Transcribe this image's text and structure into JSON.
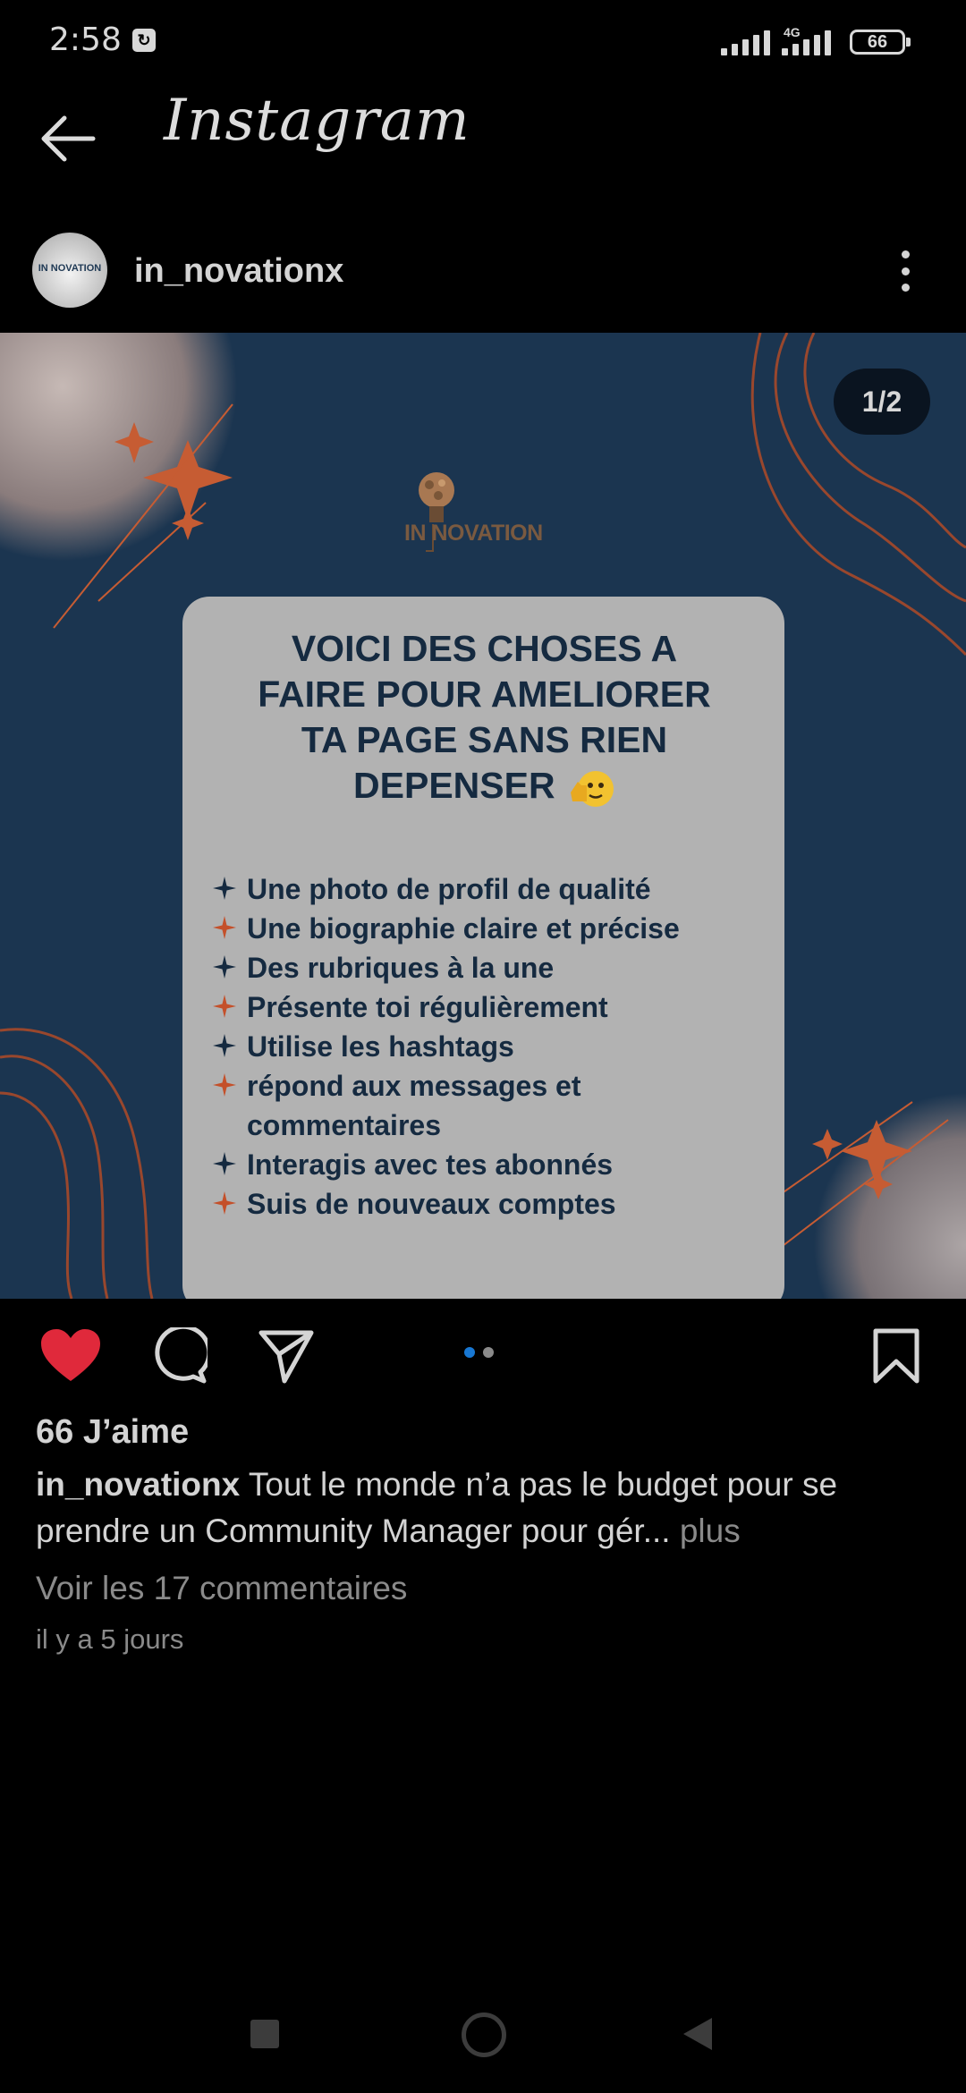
{
  "status_bar": {
    "time": "2:58",
    "network": "4G",
    "battery": "66"
  },
  "header": {
    "brand": "Instagram"
  },
  "post": {
    "username": "in_novationx",
    "avatar_text": "IN NOVATION",
    "carousel_counter": "1/2",
    "logo_text": "IN NOVATION",
    "image": {
      "title": "VOICI DES CHOSES A FAIRE POUR AMELIORER TA PAGE SANS RIEN DEPENSER",
      "title_lines": [
        "VOICI DES CHOSES A",
        "FAIRE POUR AMELIORER",
        "TA PAGE SANS RIEN",
        "DEPENSER"
      ],
      "tips": [
        {
          "text": "Une photo de profil de qualité",
          "star_color": "#152a40"
        },
        {
          "text": "Une biographie claire et précise",
          "star_color": "#c4502a"
        },
        {
          "text": "Des rubriques à la une",
          "star_color": "#152a40"
        },
        {
          "text": "Présente toi régulièrement",
          "star_color": "#c4502a"
        },
        {
          "text": "Utilise les hashtags",
          "star_color": "#152a40"
        },
        {
          "text": "répond aux messages et commentaires",
          "star_color": "#c4502a"
        },
        {
          "text": "Interagis avec tes abonnés",
          "star_color": "#152a40"
        },
        {
          "text": "Suis de nouveaux comptes",
          "star_color": "#c4502a"
        }
      ]
    },
    "likes": "66 J’aime",
    "caption_username": "in_novationx",
    "caption_text": " Tout le monde n’a pas le budget pour se prendre un Community  Manager pour gér...",
    "caption_more": " plus",
    "comments_link": "Voir les 17 commentaires",
    "date": "il y a 5 jours",
    "carousel_dots": {
      "active_color": "#1877d2",
      "inactive_color": "#8a8a8a",
      "active_index": 0,
      "count": 2
    }
  },
  "colors": {
    "like_red": "#e0293b",
    "post_bg": "#1b3550",
    "card_bg": "#b2b2b2",
    "accent_orange": "#c4502a"
  },
  "icons": [
    "back-arrow-icon",
    "heart-icon",
    "comment-icon",
    "share-icon",
    "bookmark-icon",
    "more-options-icon"
  ]
}
